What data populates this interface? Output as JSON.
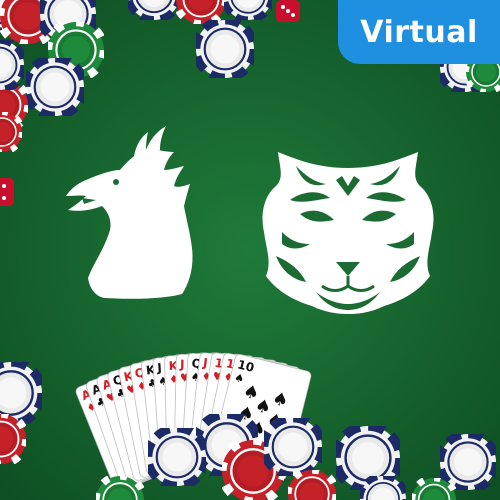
{
  "badge": {
    "label": "Virtual",
    "color": "#1f8fe0"
  },
  "colors": {
    "felt_center": "#1f7a3a",
    "felt_edge": "#0e4f23",
    "emblem": "#ffffff",
    "chip_red": "#c42128",
    "chip_green": "#1e8a3c",
    "chip_navy": "#1c2b66",
    "chip_white": "#f2f2f2",
    "dice_red": "#c8102e"
  },
  "emblems": [
    {
      "name": "dragon",
      "icon": "dragon-head-icon"
    },
    {
      "name": "tiger",
      "icon": "tiger-head-icon"
    }
  ],
  "cards": [
    {
      "rank": "A",
      "suit": "♦",
      "color": "#d11f26"
    },
    {
      "rank": "A",
      "suit": "♣",
      "color": "#111111"
    },
    {
      "rank": "A",
      "suit": "♥",
      "color": "#d11f26"
    },
    {
      "rank": "Q",
      "suit": "♣",
      "color": "#111111"
    },
    {
      "rank": "K",
      "suit": "♥",
      "color": "#d11f26"
    },
    {
      "rank": "Q",
      "suit": "♦",
      "color": "#d11f26"
    },
    {
      "rank": "K",
      "suit": "♣",
      "color": "#111111"
    },
    {
      "rank": "J",
      "suit": "♠",
      "color": "#111111"
    },
    {
      "rank": "K",
      "suit": "♦",
      "color": "#d11f26"
    },
    {
      "rank": "J",
      "suit": "♥",
      "color": "#d11f26"
    },
    {
      "rank": "Q",
      "suit": "♠",
      "color": "#111111"
    },
    {
      "rank": "J",
      "suit": "♦",
      "color": "#d11f26"
    },
    {
      "rank": "10",
      "suit": "♥",
      "color": "#d11f26"
    },
    {
      "rank": "10",
      "suit": "♦",
      "color": "#d11f26"
    },
    {
      "rank": "10",
      "suit": "♠",
      "color": "#111111"
    }
  ]
}
